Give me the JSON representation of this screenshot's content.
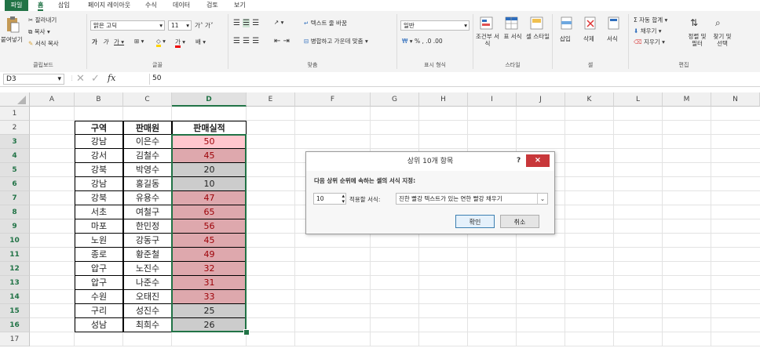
{
  "ribbon_tabs": [
    "파일",
    "홈",
    "삽입",
    "페이지 레이아웃",
    "수식",
    "데이터",
    "검토",
    "보기"
  ],
  "clipboard": {
    "paste": "붙여넣기",
    "cut": "잘라내기",
    "copy": "복사",
    "format_painter": "서식 복사",
    "label": "클립보드"
  },
  "font": {
    "name": "맑은 고딕",
    "size": "11",
    "label": "글꼴"
  },
  "alignment": {
    "wrap": "텍스트 줄 바꿈",
    "merge": "병합하고 가운데 맞춤",
    "label": "맞춤"
  },
  "number": {
    "format": "일반",
    "label": "표시 형식"
  },
  "styles": {
    "conditional": "조건부 서식",
    "table": "표 서식",
    "cell": "셀 스타일",
    "label": "스타일"
  },
  "cells": {
    "insert": "삽입",
    "delete": "삭제",
    "format": "서식",
    "label": "셀"
  },
  "editing": {
    "autosum": "자동 합계",
    "fill": "채우기",
    "clear": "지우기",
    "sort": "정렬 및 필터",
    "find": "찾기 및 선택",
    "label": "편집"
  },
  "formula_bar": {
    "name_box": "D3",
    "fx": "fx",
    "value": "50"
  },
  "columns": [
    "A",
    "B",
    "C",
    "D",
    "E",
    "F",
    "G",
    "H",
    "I",
    "J",
    "K",
    "L",
    "M",
    "N"
  ],
  "rows": [
    "1",
    "2",
    "3",
    "4",
    "5",
    "6",
    "7",
    "8",
    "9",
    "10",
    "11",
    "12",
    "13",
    "14",
    "15",
    "16",
    "17"
  ],
  "table": {
    "headers": [
      "구역",
      "판매원",
      "판매실적"
    ],
    "rows": [
      [
        "강남",
        "이은수",
        "50"
      ],
      [
        "강서",
        "김철수",
        "45"
      ],
      [
        "강북",
        "박영수",
        "20"
      ],
      [
        "강남",
        "홍길동",
        "10"
      ],
      [
        "강북",
        "유용수",
        "47"
      ],
      [
        "서초",
        "여철구",
        "65"
      ],
      [
        "마포",
        "한민정",
        "56"
      ],
      [
        "노원",
        "강동구",
        "45"
      ],
      [
        "종로",
        "황준철",
        "49"
      ],
      [
        "압구",
        "노진수",
        "32"
      ],
      [
        "압구",
        "나준수",
        "31"
      ],
      [
        "수원",
        "오태진",
        "33"
      ],
      [
        "구리",
        "성진수",
        "25"
      ],
      [
        "성남",
        "최희수",
        "26"
      ]
    ],
    "highlighted": [
      true,
      true,
      false,
      false,
      true,
      true,
      true,
      true,
      true,
      true,
      true,
      true,
      false,
      false
    ]
  },
  "colors": {
    "accent": "#217346",
    "highlight_fill": "#dea8ad",
    "highlight_fill_active": "#ffc7ce",
    "highlight_text": "#9c0006",
    "grey_fill": "#cccccc",
    "close_red": "#c8373a"
  },
  "dialog": {
    "title": "상위 10개 항목",
    "help": "?",
    "prompt": "다음 상위 순위에 속하는 셀의 서식 지정:",
    "count": "10",
    "with_label": "적용할 서식:",
    "format_value": "진한 빨강 텍스트가 있는 연한 빨강 채우기",
    "ok": "확인",
    "cancel": "취소"
  }
}
